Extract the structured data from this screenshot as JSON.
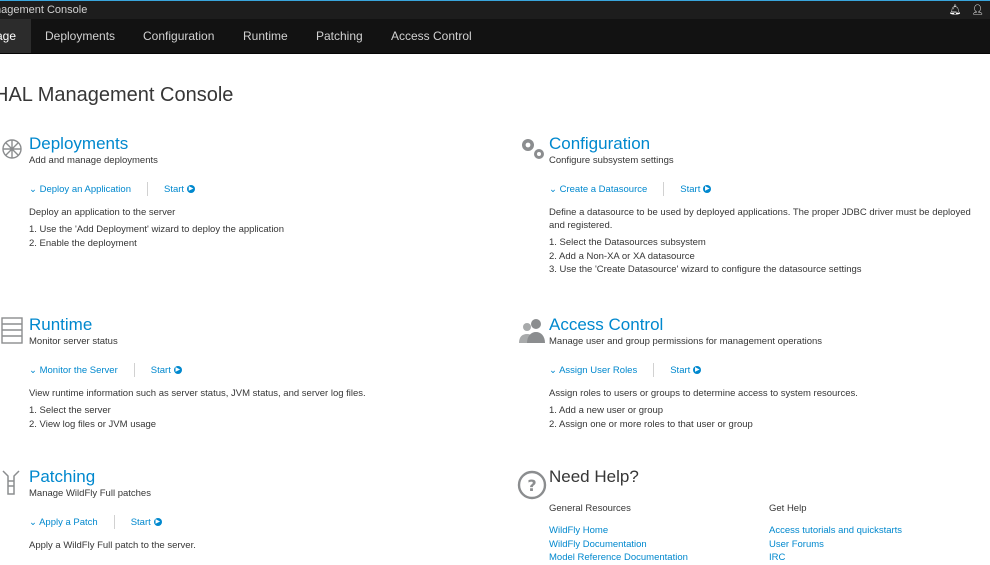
{
  "topbar": {
    "brand": "nagement Console",
    "bell_icon": "bell-icon",
    "user_icon": "user-icon"
  },
  "nav": {
    "items": [
      {
        "label": "age",
        "active": true
      },
      {
        "label": "Deployments"
      },
      {
        "label": "Configuration"
      },
      {
        "label": "Runtime"
      },
      {
        "label": "Patching"
      },
      {
        "label": "Access Control"
      }
    ]
  },
  "page": {
    "title": "HAL Management Console"
  },
  "sections": {
    "deployments": {
      "title": "Deployments",
      "subtitle": "Add and manage deployments",
      "action": "Deploy an Application",
      "start": "Start",
      "description": "Deploy an application to the server",
      "steps": [
        "1. Use the 'Add Deployment' wizard to deploy the application",
        "2. Enable the deployment"
      ]
    },
    "configuration": {
      "title": "Configuration",
      "subtitle": "Configure subsystem settings",
      "action": "Create a Datasource",
      "start": "Start",
      "description": "Define a datasource to be used by deployed applications. The proper JDBC driver must be deployed and registered.",
      "steps": [
        "1. Select the Datasources subsystem",
        "2. Add a Non-XA or XA datasource",
        "3. Use the 'Create Datasource' wizard to configure the datasource settings"
      ]
    },
    "runtime": {
      "title": "Runtime",
      "subtitle": "Monitor server status",
      "action": "Monitor the Server",
      "start": "Start",
      "description": "View runtime information such as server status, JVM status, and server log files.",
      "steps": [
        "1. Select the server",
        "2. View log files or JVM usage"
      ]
    },
    "access": {
      "title": "Access Control",
      "subtitle": "Manage user and group permissions for management operations",
      "action": "Assign User Roles",
      "start": "Start",
      "description": "Assign roles to users or groups to determine access to system resources.",
      "steps": [
        "1. Add a new user or group",
        "2. Assign one or more roles to that user or group"
      ]
    },
    "patching": {
      "title": "Patching",
      "subtitle": "Manage WildFly Full patches",
      "action": "Apply a Patch",
      "start": "Start",
      "description": "Apply a WildFly Full patch to the server."
    },
    "help": {
      "title": "Need Help?",
      "general": {
        "heading": "General Resources",
        "links": [
          "WildFly Home",
          "WildFly Documentation",
          "Model Reference Documentation"
        ]
      },
      "gethelp": {
        "heading": "Get Help",
        "links": [
          "Access tutorials and quickstarts",
          "User Forums",
          "IRC"
        ]
      }
    }
  }
}
